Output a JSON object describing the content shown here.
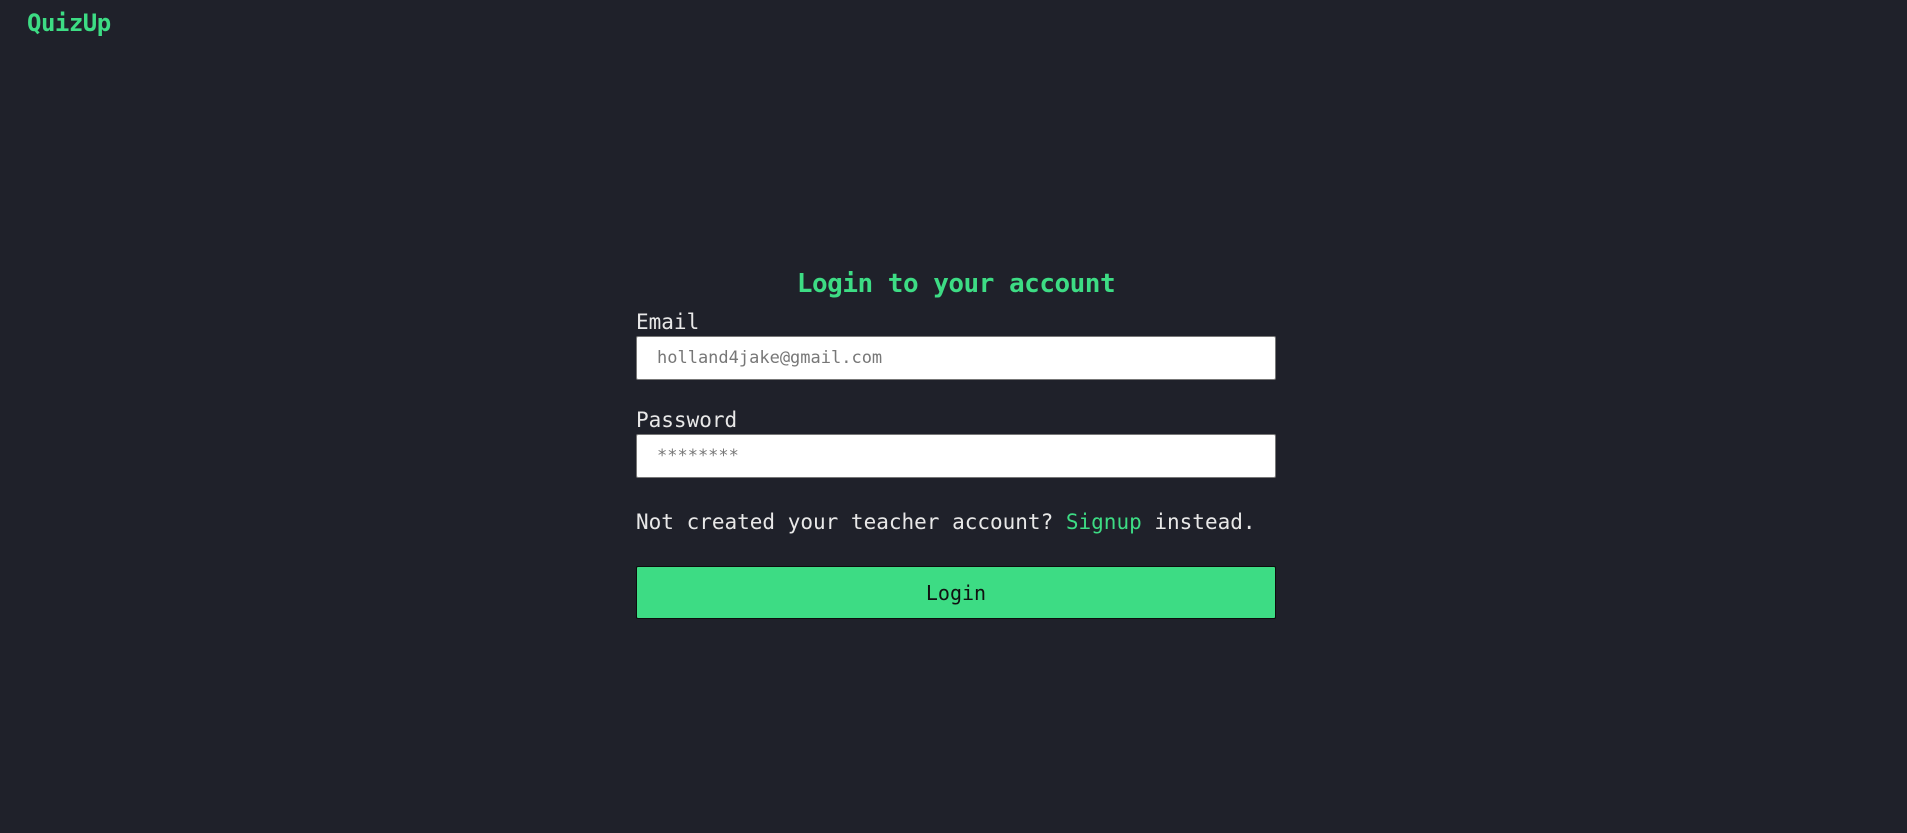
{
  "header": {
    "brand": "QuizUp"
  },
  "form": {
    "title": "Login to your account",
    "email": {
      "label": "Email",
      "value": "",
      "placeholder": "holland4jake@gmail.com"
    },
    "password": {
      "label": "Password",
      "value": "",
      "placeholder": "********"
    },
    "signup": {
      "prefix": "Not created your teacher account? ",
      "link": "Signup",
      "suffix": " instead."
    },
    "submit_label": "Login"
  },
  "colors": {
    "background": "#1f212a",
    "accent": "#3ddc84",
    "text": "#e8e8e8",
    "input_background": "#ffffff"
  }
}
